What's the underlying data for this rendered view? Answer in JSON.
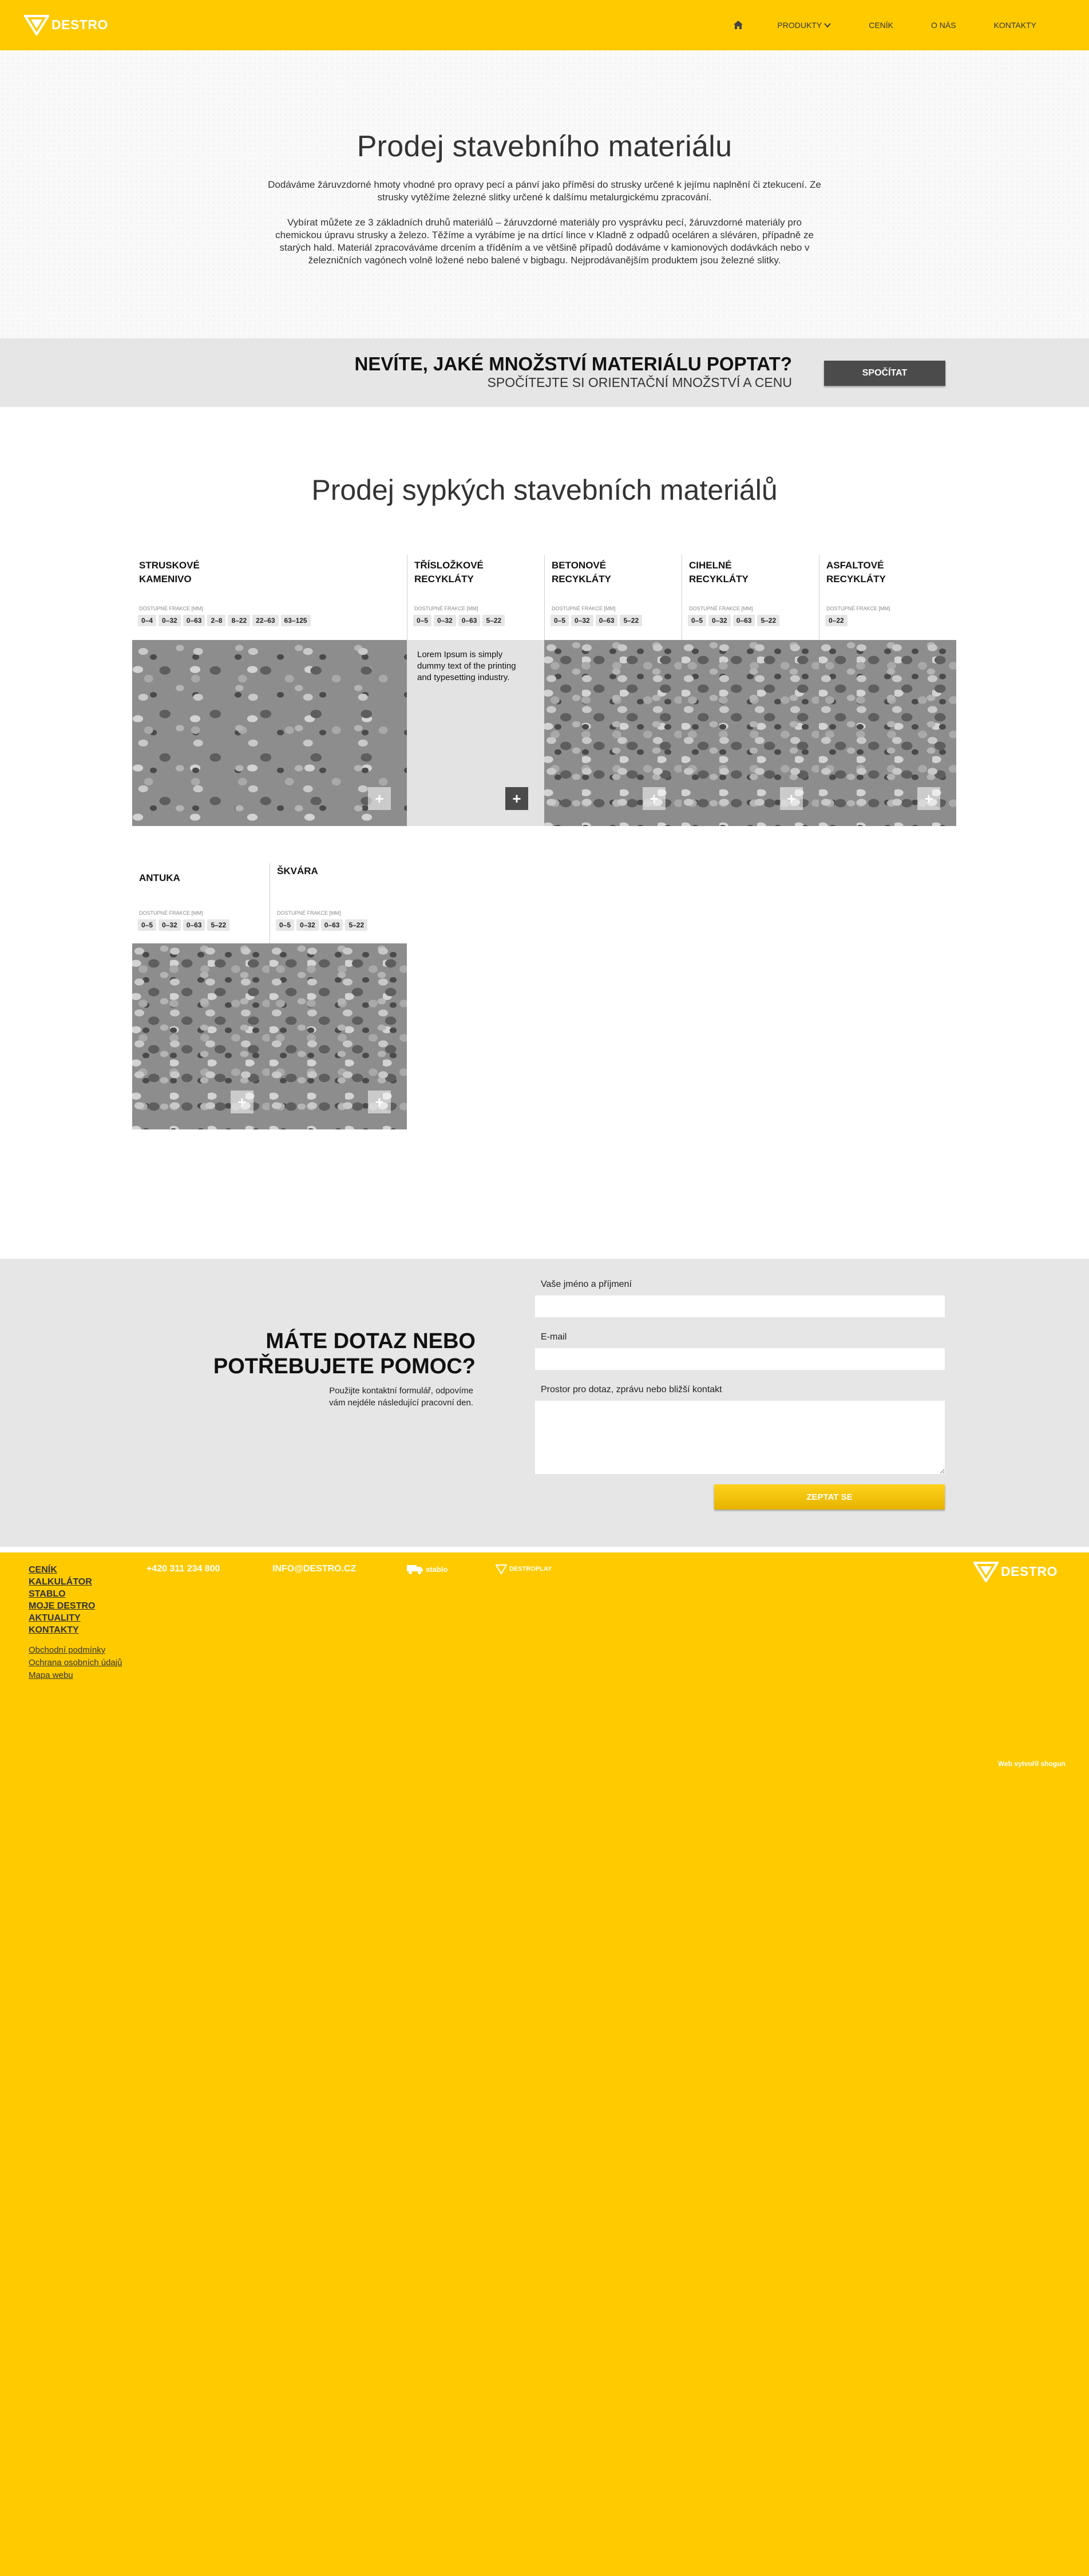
{
  "header": {
    "logo_text": "DESTRO",
    "nav": {
      "home_icon": "home-icon",
      "items": [
        {
          "label": "PRODUKTY",
          "has_dropdown": true
        },
        {
          "label": "CENÍK"
        },
        {
          "label": "O NÁS"
        },
        {
          "label": "KONTAKTY"
        }
      ]
    }
  },
  "hero": {
    "title": "Prodej stavebního materiálu",
    "paragraph_1": "Dodáváme žáruvzdorné hmoty vhodné pro opravy pecí a pánví jako příměsi do strusky určené k jejímu naplnění či ztekucení. Ze strusky vytěžíme železné slitky určené k dalšímu metalurgickému zpracování.",
    "paragraph_2": "Vybírat můžete ze 3 základních druhů materiálů – žáruvzdorné materiály pro vysprávku pecí, žáruvzdorné materiály pro chemickou úpravu strusky a železo. Těžíme a vyrábíme je na drtící lince v Kladně z odpadů oceláren a sléváren, případně ze starých hald. Materiál zpracováváme drcením a tříděním a ve většině případů dodáváme v kamionových dodávkách nebo v železničních vagónech volně ložené nebo balené v bigbagu. Nejprodávanějším produktem jsou železné slitky."
  },
  "calc": {
    "title": "NEVÍTE, JAKÉ MNOŽSTVÍ MATERIÁLU POPTAT?",
    "subtitle": "SPOČÍTEJTE SI ORIENTAČNÍ MNOŽSTVÍ A CENU",
    "button": "SPOČÍTAT"
  },
  "products": {
    "title": "Prodej sypkých stavebních materiálů",
    "fraction_label": "DOSTUPNÉ FRAKCE [mm]",
    "plus_icon": "plus-icon",
    "items": [
      {
        "name_1": "STRUSKOVÉ",
        "name_2": "KAMENIVO",
        "fractions": [
          "0–4",
          "0–32",
          "0–63",
          "2–8",
          "8–22",
          "22–63",
          "63–125"
        ]
      },
      {
        "name_1": "TŘÍSLOŽKOVÉ",
        "name_2": "RECYKLÁTY",
        "fractions": [
          "0–5",
          "0–32",
          "0–63",
          "5–22"
        ],
        "description": "Lorem Ipsum is simply dummy text of the printing and typesetting industry."
      },
      {
        "name_1": "BETONOVÉ",
        "name_2": "RECYKLÁTY",
        "fractions": [
          "0–5",
          "0–32",
          "0–63",
          "5–22"
        ]
      },
      {
        "name_1": "CIHELNÉ",
        "name_2": "RECYKLÁTY",
        "fractions": [
          "0–5",
          "0–32",
          "0–63",
          "5–22"
        ]
      },
      {
        "name_1": "ASFALTOVÉ",
        "name_2": "RECYKLÁTY",
        "fractions": [
          "0–22"
        ]
      },
      {
        "name_1": "ANTUKA",
        "name_2": "",
        "fractions": [
          "0–5",
          "0–32",
          "0–63",
          "5–22"
        ]
      },
      {
        "name_1": "ŠKVÁRA",
        "name_2": "",
        "fractions": [
          "0–5",
          "0–32",
          "0–63",
          "5–22"
        ]
      }
    ]
  },
  "contact": {
    "title_1": "MÁTE DOTAZ NEBO",
    "title_2": "POTŘEBUJETE POMOC?",
    "sub_1": "Použijte kontaktní formulář, odpovíme",
    "sub_2": "vám nejdéle následující pracovní den.",
    "name_label": "Vaše jméno a příjmení",
    "email_label": "E-mail",
    "message_label": "Prostor pro dotaz, zprávu nebo bližší kontakt",
    "submit": "ZEPTAT SE"
  },
  "footer": {
    "nav": [
      "CENÍK",
      "KALKULÁTOR",
      "STABLO",
      "MOJE DESTRO",
      "AKTUALITY",
      "KONTAKTY"
    ],
    "links": [
      "Obchodní podmínky",
      "Ochrana osobních údajů",
      "Mapa webu"
    ],
    "phone": "+420 311 234 800",
    "email": "INFO@DESTRO.CZ",
    "stablo": "stablo",
    "destroplay": "DESTROPLAY",
    "logo_text": "DESTRO",
    "credit": "Web vytvořil shogun"
  },
  "colors": {
    "brand_yellow": "#ffcb00",
    "dark_button": "#4b4b4b",
    "band_gray": "#e6e6e6"
  }
}
